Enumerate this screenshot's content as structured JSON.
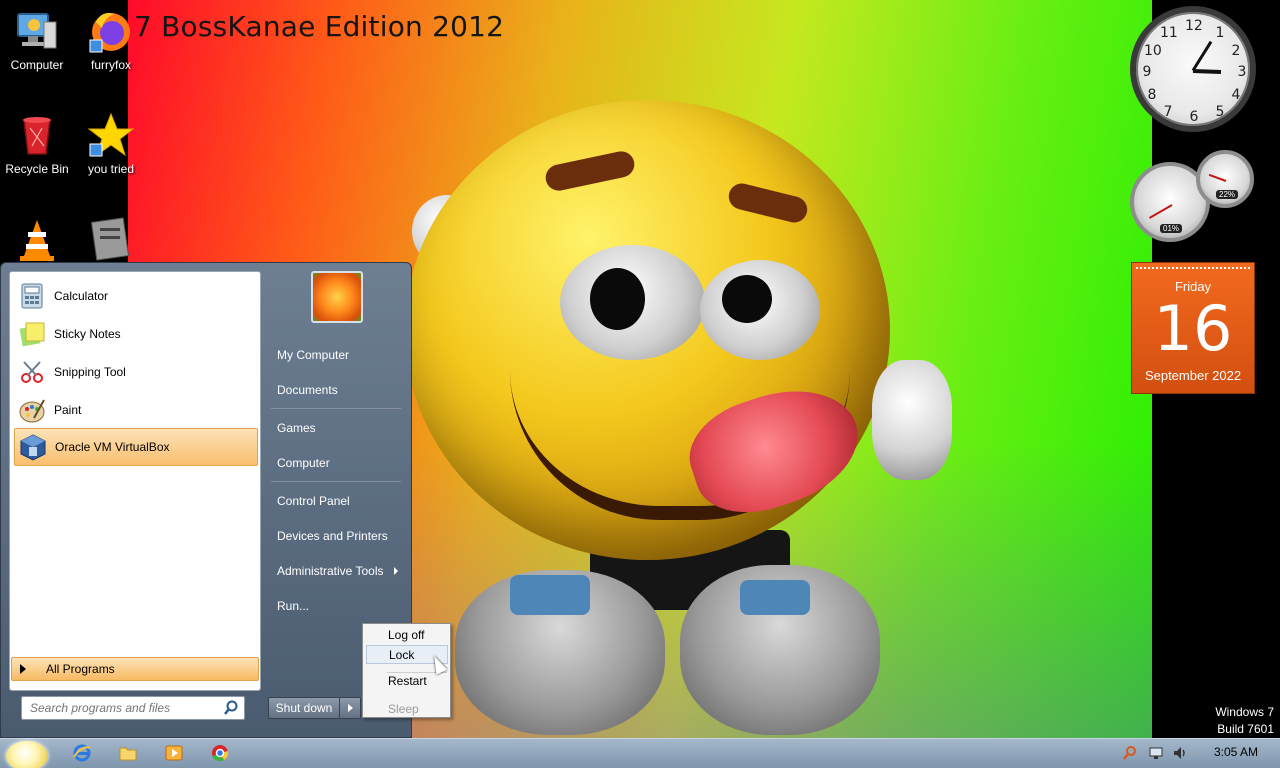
{
  "wallpaper": {
    "title": "7 BossKanae Edition 2012"
  },
  "desktop_icons": [
    {
      "label": "Computer",
      "icon": "computer-icon"
    },
    {
      "label": "furryfox",
      "icon": "firefox-icon"
    },
    {
      "label": "Recycle Bin",
      "icon": "recycle-bin-icon"
    },
    {
      "label": "you tried",
      "icon": "star-icon"
    },
    {
      "label": "",
      "icon": "vlc-icon"
    },
    {
      "label": "",
      "icon": "document-icon"
    }
  ],
  "start_menu": {
    "pinned_programs": [
      {
        "label": "Calculator",
        "icon": "calculator-icon"
      },
      {
        "label": "Sticky Notes",
        "icon": "sticky-notes-icon"
      },
      {
        "label": "Snipping Tool",
        "icon": "scissors-icon"
      },
      {
        "label": "Paint",
        "icon": "paint-palette-icon"
      },
      {
        "label": "Oracle VM VirtualBox",
        "icon": "virtualbox-icon",
        "highlighted": true
      }
    ],
    "all_programs_label": "All Programs",
    "search_placeholder": "Search programs and files",
    "right_items": [
      "My Computer",
      "Documents",
      "Games",
      "Computer",
      "Control Panel",
      "Devices and Printers",
      "Administrative Tools",
      "Run..."
    ],
    "shutdown_label": "Shut down"
  },
  "shutdown_menu": {
    "items": [
      "Log off",
      "Lock",
      "Restart",
      "Sleep"
    ],
    "hovered": "Lock",
    "disabled": "Sleep"
  },
  "gadgets": {
    "clock": {
      "numbers": [
        "12",
        "1",
        "2",
        "3",
        "4",
        "5",
        "6",
        "7",
        "8",
        "9",
        "10",
        "11"
      ],
      "time": "3:05"
    },
    "cpu_meter": {
      "cpu": "01%",
      "memory": "22%"
    },
    "calendar": {
      "day": "Friday",
      "date": "16",
      "month_year": "September 2022"
    }
  },
  "os_badge": {
    "line1": "Windows 7",
    "line2": "Build 7601"
  },
  "taskbar": {
    "pinned": [
      "internet-explorer-icon",
      "folder-icon",
      "media-player-icon",
      "chrome-icon"
    ],
    "tray": [
      "search-icon",
      "network-icon",
      "volume-icon"
    ],
    "time": "3:05 AM"
  },
  "colors": {
    "highlight": "#f9bf6e",
    "calendar": "#e55c16",
    "start_menu": "#5a6b80"
  }
}
